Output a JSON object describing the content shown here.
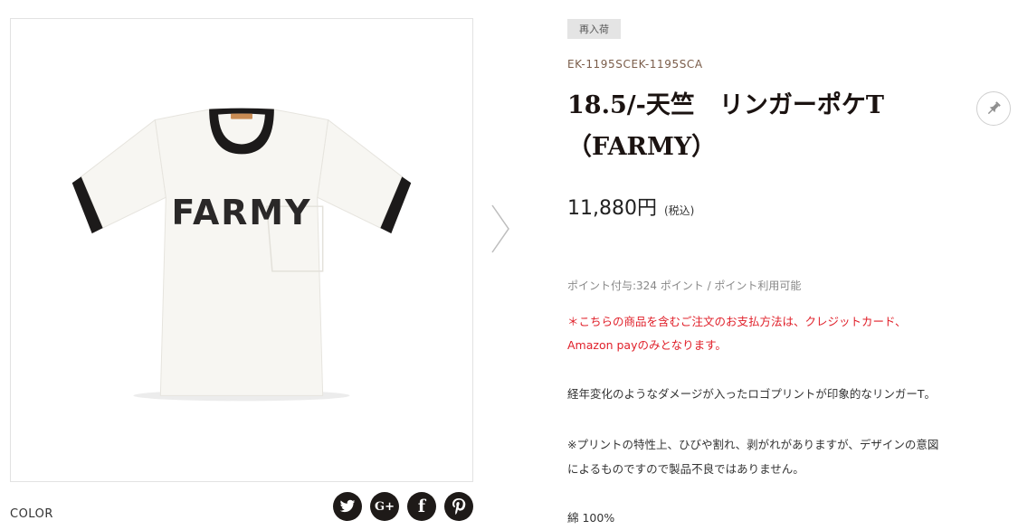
{
  "product": {
    "badge": "再入荷",
    "sku": "EK-1195SCEK-1195SCA",
    "title_line1": "18.5/-天竺　リンガーポケT",
    "title_line2": "（FARMY）",
    "price": "11,880円",
    "tax_note": "(税込)",
    "points": "ポイント付与:324 ポイント / ポイント利用可能",
    "notice_line1": "＊こちらの商品を含むご注文のお支払方法は、クレジットカード、",
    "notice_line2": "Amazon payのみとなります。",
    "description": "経年変化のようなダメージが入ったロゴプリントが印象的なリンガーT。",
    "print_note_line1": "※プリントの特性上、ひびや割れ、剥がれがありますが、デザインの意図",
    "print_note_line2": "によるものですので製品不良ではありません。",
    "material": "綿 100%"
  },
  "image": {
    "shirt_print": "FARMY",
    "shirt_color": "#f7f6f2",
    "trim_color": "#1c1a1a"
  },
  "gallery": {
    "color_label": "COLOR",
    "next_icon": "chevron-right-icon"
  },
  "share": {
    "icons": [
      "twitter-icon",
      "google-plus-icon",
      "facebook-icon",
      "pinterest-icon"
    ],
    "google_plus_text": "G+",
    "facebook_text": "f"
  },
  "colors": {
    "notice": "#e0202a",
    "sku": "#7a5c49",
    "share_bg": "#1e1a18"
  }
}
